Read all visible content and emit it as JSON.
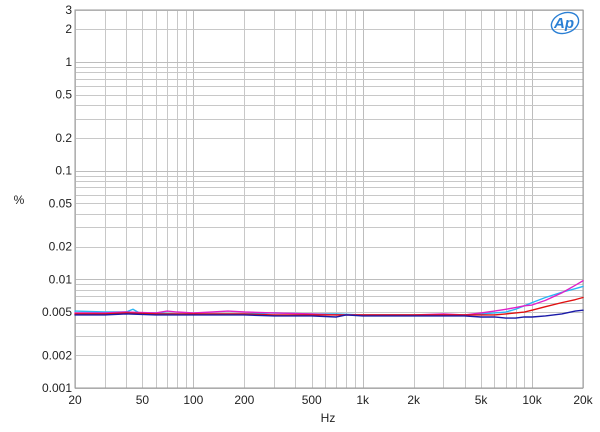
{
  "chart_data": {
    "type": "line",
    "title": "",
    "xlabel": "Hz",
    "ylabel": "%",
    "x_scale": "log",
    "y_scale": "log",
    "xlim": [
      20,
      20000
    ],
    "ylim": [
      0.001,
      3
    ],
    "grid": true,
    "x_ticks": [
      {
        "value": 20,
        "label": "20"
      },
      {
        "value": 50,
        "label": "50"
      },
      {
        "value": 100,
        "label": "100"
      },
      {
        "value": 200,
        "label": "200"
      },
      {
        "value": 500,
        "label": "500"
      },
      {
        "value": 1000,
        "label": "1k"
      },
      {
        "value": 2000,
        "label": "2k"
      },
      {
        "value": 5000,
        "label": "5k"
      },
      {
        "value": 10000,
        "label": "10k"
      },
      {
        "value": 20000,
        "label": "20k"
      }
    ],
    "y_ticks": [
      {
        "value": 3,
        "label": "3"
      },
      {
        "value": 2,
        "label": "2"
      },
      {
        "value": 1,
        "label": "1"
      },
      {
        "value": 0.5,
        "label": "0.5"
      },
      {
        "value": 0.2,
        "label": "0.2"
      },
      {
        "value": 0.1,
        "label": "0.1"
      },
      {
        "value": 0.05,
        "label": "0.05"
      },
      {
        "value": 0.02,
        "label": "0.02"
      },
      {
        "value": 0.01,
        "label": "0.01"
      },
      {
        "value": 0.005,
        "label": "0.005"
      },
      {
        "value": 0.002,
        "label": "0.002"
      },
      {
        "value": 0.001,
        "label": "0.001"
      }
    ],
    "series": [
      {
        "color": "#29b6f6",
        "points": [
          [
            20,
            0.0051
          ],
          [
            30,
            0.005
          ],
          [
            40,
            0.005
          ],
          [
            44,
            0.0053
          ],
          [
            48,
            0.0049
          ],
          [
            60,
            0.0049
          ],
          [
            80,
            0.0048
          ],
          [
            100,
            0.0048
          ],
          [
            150,
            0.0048
          ],
          [
            200,
            0.0048
          ],
          [
            300,
            0.0049
          ],
          [
            500,
            0.0048
          ],
          [
            700,
            0.0048
          ],
          [
            1000,
            0.0047
          ],
          [
            2000,
            0.0047
          ],
          [
            3000,
            0.0047
          ],
          [
            4000,
            0.0047
          ],
          [
            5000,
            0.0048
          ],
          [
            6000,
            0.0049
          ],
          [
            7000,
            0.005
          ],
          [
            8000,
            0.0053
          ],
          [
            9000,
            0.0057
          ],
          [
            10000,
            0.0061
          ],
          [
            12000,
            0.0068
          ],
          [
            15000,
            0.0076
          ],
          [
            18000,
            0.0082
          ],
          [
            20000,
            0.0086
          ]
        ]
      },
      {
        "color": "#e020c8",
        "points": [
          [
            20,
            0.0049
          ],
          [
            30,
            0.0049
          ],
          [
            40,
            0.005
          ],
          [
            60,
            0.0049
          ],
          [
            70,
            0.0051
          ],
          [
            80,
            0.005
          ],
          [
            100,
            0.0049
          ],
          [
            130,
            0.005
          ],
          [
            160,
            0.0051
          ],
          [
            200,
            0.005
          ],
          [
            300,
            0.0049
          ],
          [
            500,
            0.0048
          ],
          [
            700,
            0.0047
          ],
          [
            1000,
            0.0047
          ],
          [
            2000,
            0.0047
          ],
          [
            3000,
            0.0048
          ],
          [
            4000,
            0.0047
          ],
          [
            5000,
            0.0049
          ],
          [
            6000,
            0.0051
          ],
          [
            7000,
            0.0053
          ],
          [
            8000,
            0.0055
          ],
          [
            9000,
            0.0057
          ],
          [
            10000,
            0.0058
          ],
          [
            12000,
            0.0064
          ],
          [
            15000,
            0.0075
          ],
          [
            18000,
            0.0088
          ],
          [
            20000,
            0.0097
          ]
        ]
      },
      {
        "color": "#e01010",
        "points": [
          [
            20,
            0.0048
          ],
          [
            30,
            0.0048
          ],
          [
            40,
            0.0049
          ],
          [
            60,
            0.0048
          ],
          [
            100,
            0.0048
          ],
          [
            150,
            0.0048
          ],
          [
            200,
            0.0048
          ],
          [
            300,
            0.0047
          ],
          [
            500,
            0.0047
          ],
          [
            700,
            0.0047
          ],
          [
            1000,
            0.0047
          ],
          [
            2000,
            0.0047
          ],
          [
            3000,
            0.0047
          ],
          [
            4000,
            0.0047
          ],
          [
            5000,
            0.0047
          ],
          [
            6000,
            0.0047
          ],
          [
            7000,
            0.0048
          ],
          [
            8000,
            0.0049
          ],
          [
            9000,
            0.005
          ],
          [
            10000,
            0.0052
          ],
          [
            12000,
            0.0056
          ],
          [
            15000,
            0.0061
          ],
          [
            18000,
            0.0065
          ],
          [
            20000,
            0.0068
          ]
        ]
      },
      {
        "color": "#1a1aa8",
        "points": [
          [
            20,
            0.0047
          ],
          [
            30,
            0.0047
          ],
          [
            40,
            0.0048
          ],
          [
            60,
            0.0047
          ],
          [
            100,
            0.0047
          ],
          [
            150,
            0.0047
          ],
          [
            200,
            0.0047
          ],
          [
            300,
            0.0046
          ],
          [
            500,
            0.0046
          ],
          [
            700,
            0.0045
          ],
          [
            800,
            0.0047
          ],
          [
            1000,
            0.0046
          ],
          [
            2000,
            0.0046
          ],
          [
            3000,
            0.0046
          ],
          [
            4000,
            0.0046
          ],
          [
            5000,
            0.0045
          ],
          [
            6000,
            0.0045
          ],
          [
            7000,
            0.0044
          ],
          [
            8000,
            0.0044
          ],
          [
            9000,
            0.0045
          ],
          [
            10000,
            0.0045
          ],
          [
            12000,
            0.0046
          ],
          [
            15000,
            0.0048
          ],
          [
            18000,
            0.0051
          ],
          [
            20000,
            0.0052
          ]
        ]
      }
    ]
  },
  "logo": {
    "text": "Ap",
    "color": "#2a7fd4"
  }
}
